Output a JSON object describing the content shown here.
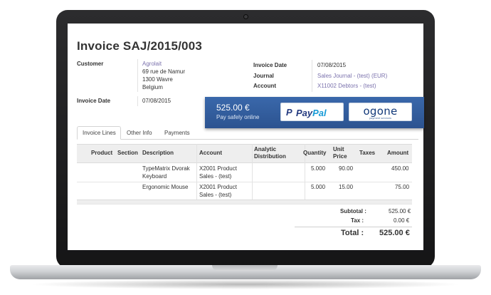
{
  "invoice": {
    "title": "Invoice SAJ/2015/003",
    "customer_label": "Customer",
    "customer_name": "Agrolait",
    "customer_address": [
      "69 rue de Namur",
      "1300 Wavre",
      "Belgium"
    ],
    "invoice_date_label": "Invoice Date",
    "invoice_date": "07/08/2015",
    "right_invoice_date_label": "Invoice Date",
    "right_invoice_date": "07/08/2015",
    "journal_label": "Journal",
    "journal": "Sales Journal - (test) (EUR)",
    "account_label": "Account",
    "account": "X11002 Debtors - (test)"
  },
  "tabs": [
    {
      "label": "Invoice Lines",
      "active": true
    },
    {
      "label": "Other Info",
      "active": false
    },
    {
      "label": "Payments",
      "active": false
    }
  ],
  "table": {
    "headers": {
      "product": "Product",
      "section": "Section",
      "description": "Description",
      "account": "Account",
      "analytic": [
        "Analytic",
        "Distribution"
      ],
      "quantity": "Quantity",
      "unit_price": [
        "Unit",
        "Price"
      ],
      "taxes": "Taxes",
      "amount": "Amount"
    },
    "rows": [
      {
        "description": [
          "TypeMatrix Dvorak",
          "Keyboard"
        ],
        "account": [
          "X2001 Product",
          "Sales - (test)"
        ],
        "quantity": "5.000",
        "unit_price": "90.00",
        "amount": "450.00"
      },
      {
        "description": [
          "Ergonomic Mouse"
        ],
        "account": [
          "X2001 Product",
          "Sales - (test)"
        ],
        "quantity": "5.000",
        "unit_price": "15.00",
        "amount": "75.00"
      }
    ]
  },
  "totals": {
    "subtotal_label": "Subtotal :",
    "subtotal": "525.00 €",
    "tax_label": "Tax :",
    "tax": "0.00 €",
    "total_label": "Total :",
    "total": "525.00 €"
  },
  "payment": {
    "amount": "525.00 €",
    "subtitle": "Pay safely online",
    "paypal_icon": "P",
    "paypal_pay": "Pay",
    "paypal_pal": "Pal",
    "ogone_logo": "ogone",
    "ogone_tagline": "payment services",
    "colors": {
      "bar": "#2f5a98",
      "paypal_dark": "#253b80",
      "paypal_light": "#179bd7",
      "ogone": "#12397a"
    }
  },
  "colors": {
    "link": "#7b72ad",
    "header_bg": "#eeeeee"
  }
}
